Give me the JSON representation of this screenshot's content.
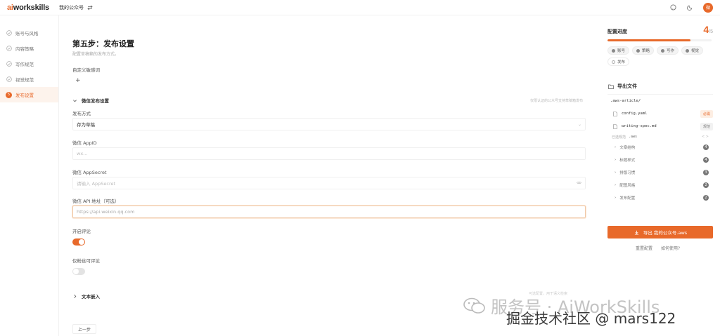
{
  "colors": {
    "accent": "#e8692a",
    "muted": "#aaaaaa"
  },
  "topbar": {
    "logo_ai": "ai",
    "logo_rest": "workskills",
    "project": "我的公众号",
    "switch_icon": "swap-icon",
    "avatar": "微"
  },
  "sidebar": {
    "items": [
      {
        "label": "账号与风格",
        "icon": "check-icon",
        "active": false
      },
      {
        "label": "内容策略",
        "icon": "check-icon",
        "active": false
      },
      {
        "label": "写作规范",
        "icon": "check-icon",
        "active": false
      },
      {
        "label": "视觉规范",
        "icon": "check-icon",
        "active": false
      },
      {
        "label": "发布设置",
        "icon": "5",
        "active": true
      }
    ]
  },
  "main": {
    "title": "第五步：发布设置",
    "subtitle": "配置草稿箱的发布方式。",
    "custom_keywords_label": "自定义敏感词",
    "wechat_section": "微信发布设置",
    "wechat_hint": "仅限认证的公众号支持草稿箱发布",
    "publish_mode_label": "发布方式",
    "publish_mode_value": "存为草稿",
    "appid_label": "微信 AppID",
    "appid_placeholder": "wx...",
    "appsecret_label": "微信 AppSecret",
    "appsecret_placeholder": "请输入 AppSecret",
    "api_label": "微信 API 地址（可选）",
    "api_placeholder": "https://api.weixin.qq.com",
    "comments_label": "开启评论",
    "comments_on": true,
    "fans_only_label": "仅粉丝可评论",
    "fans_only_on": false,
    "text_embed_section": "文本嵌入",
    "text_embed_hint": "可选配置，用于语义检索",
    "prev_button": "上一步"
  },
  "panel": {
    "progress_title": "配置进度",
    "progress_current": "4",
    "progress_total": "/5",
    "progress_fraction": 0.8,
    "chips": [
      {
        "label": "账号",
        "done": true
      },
      {
        "label": "策略",
        "done": true
      },
      {
        "label": "写作",
        "done": true
      },
      {
        "label": "视觉",
        "done": true
      },
      {
        "label": "发布",
        "done": false
      }
    ],
    "export_title": "导出文件",
    "tree_root": ".aws-article/",
    "files": [
      {
        "name": "config.yaml",
        "tag": "必需",
        "tag_kind": "warn"
      },
      {
        "name": "writing-spec.md",
        "tag": "规范",
        "tag_kind": "neutral"
      }
    ],
    "sub_label": "已选规范",
    "sub_path": ".aws",
    "groups": [
      {
        "label": "文章结构",
        "count": "4"
      },
      {
        "label": "标题样式",
        "count": "4"
      },
      {
        "label": "排版习惯",
        "count": "3"
      },
      {
        "label": "配图风格",
        "count": "2"
      },
      {
        "label": "发布配置",
        "count": "2"
      }
    ],
    "export_button": "导出 我的公众号.aws",
    "link_reset": "重置配置",
    "link_help": "如何使用?"
  },
  "overlay": {
    "watermark": "服务号 · AiWorkSkills",
    "credit": "掘金技术社区 @ mars122"
  }
}
